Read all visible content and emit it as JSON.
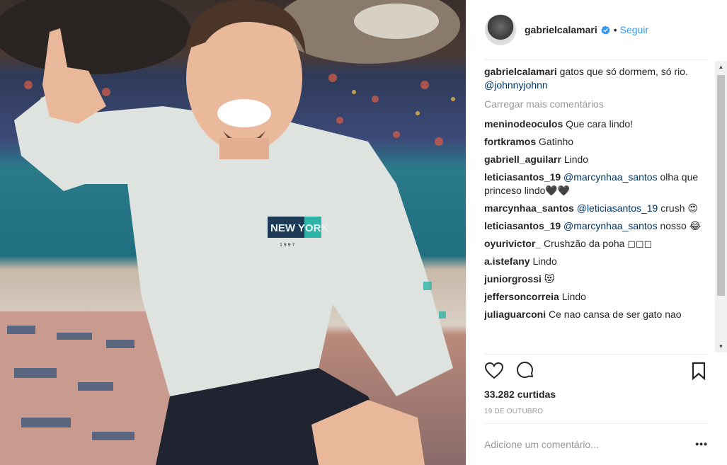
{
  "post": {
    "username": "gabrielcalamari",
    "separator": "•",
    "follow_label": "Seguir",
    "caption_user": "gabrielcalamari",
    "caption_text": " gatos que só dormem, só rio. ",
    "caption_mention": "@johnnyjohnn",
    "load_more": "Carregar mais comentários",
    "likes": "33.282 curtidas",
    "date": "19 DE OUTUBRO",
    "add_comment_placeholder": "Adicione um comentário...",
    "more_label": "•••"
  },
  "comments": [
    {
      "user": "meninodeoculos",
      "mention": "",
      "text": " Que cara lindo!"
    },
    {
      "user": "fortkramos",
      "mention": "",
      "text": " Gatinho"
    },
    {
      "user": "gabriell_aguilarr",
      "mention": "",
      "text": " Lindo"
    },
    {
      "user": "leticiasantos_19",
      "mention": " @marcynhaa_santos",
      "text": " olha que princeso lindo🖤🖤"
    },
    {
      "user": "marcynhaa_santos",
      "mention": " @leticiasantos_19",
      "text": " crush 😍"
    },
    {
      "user": "leticiasantos_19",
      "mention": " @marcynhaa_santos",
      "text": " nosso 😂"
    },
    {
      "user": "oyurivictor_",
      "mention": "",
      "text": " Crushzão da poha ◻◻◻"
    },
    {
      "user": "a.istefany",
      "mention": "",
      "text": " Lindo"
    },
    {
      "user": "juniorgrossi",
      "mention": "",
      "text": " 😻"
    },
    {
      "user": "jeffersoncorreia",
      "mention": "",
      "text": " Lindo"
    },
    {
      "user": "juliaguarconi",
      "mention": "",
      "text": " Ce nao cansa de ser gato nao"
    }
  ],
  "photo": {
    "shirt_text": "NEW YORK",
    "shirt_year": "1 9 9 7"
  },
  "colors": {
    "link": "#3897f0",
    "mention": "#003569",
    "muted": "#999999"
  },
  "icons": [
    "heart-icon",
    "comment-icon",
    "bookmark-icon",
    "verified-badge-icon"
  ]
}
